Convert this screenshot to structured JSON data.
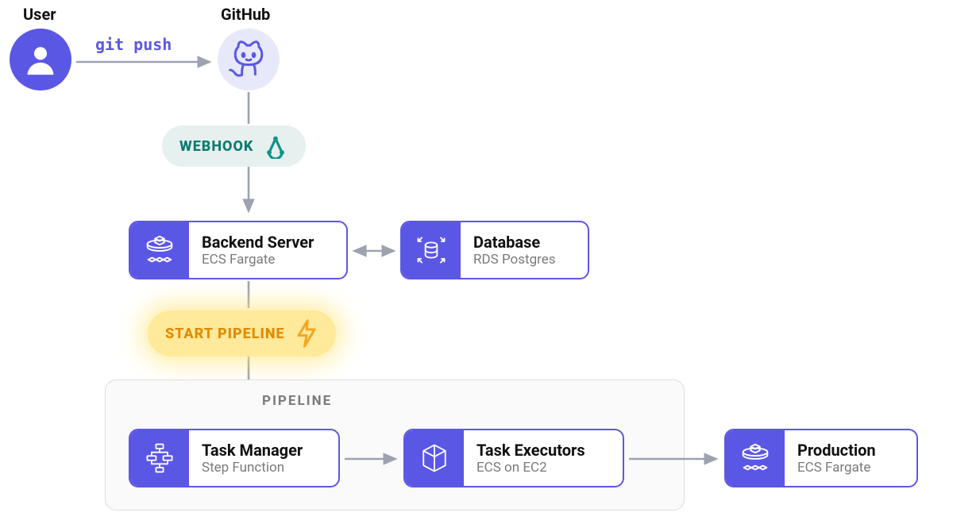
{
  "actors": {
    "user": {
      "label": "User"
    },
    "github": {
      "label": "GitHub"
    }
  },
  "edges": {
    "git_push": "git push",
    "webhook": "WEBHOOK",
    "start_pipeline": "START PIPELINE"
  },
  "nodes": {
    "backend": {
      "title": "Backend Server",
      "subtitle": "ECS Fargate",
      "icon": "ecs-fargate-icon"
    },
    "database": {
      "title": "Database",
      "subtitle": "RDS Postgres",
      "icon": "rds-icon"
    },
    "task_manager": {
      "title": "Task Manager",
      "subtitle": "Step Function",
      "icon": "step-function-icon"
    },
    "task_executors": {
      "title": "Task Executors",
      "subtitle": "ECS on EC2",
      "icon": "ecs-ec2-icon"
    },
    "production": {
      "title": "Production",
      "subtitle": "ECS Fargate",
      "icon": "ecs-fargate-icon"
    }
  },
  "groups": {
    "pipeline": "PIPELINE"
  },
  "colors": {
    "accent": "#5b57e5",
    "teal": "#0d9488",
    "amber": "#f5a623",
    "arrow": "#9ca3af"
  }
}
